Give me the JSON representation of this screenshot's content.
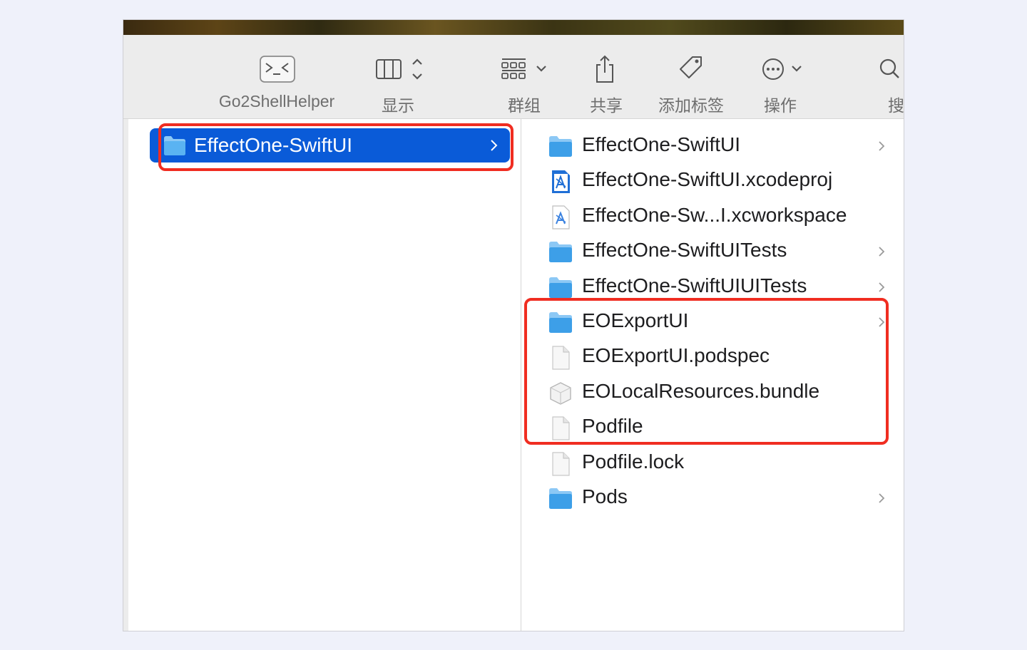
{
  "colors": {
    "selection": "#0a5bd8",
    "annotation": "#f02d21",
    "folder": "#3d9fe8",
    "toolbar_bg": "#ececec"
  },
  "toolbar": {
    "items": [
      {
        "label": "Go2ShellHelper",
        "icon": "terminal-icon"
      },
      {
        "label": "显示",
        "icon": "columns-view-icon"
      },
      {
        "label": "群组",
        "icon": "group-grid-icon"
      },
      {
        "label": "共享",
        "icon": "share-icon"
      },
      {
        "label": "添加标签",
        "icon": "tag-icon"
      },
      {
        "label": "操作",
        "icon": "ellipsis-circle-icon"
      },
      {
        "label": "搜索",
        "icon": "search-icon"
      }
    ]
  },
  "left_column": {
    "selected": {
      "name": "EffectOne-SwiftUI",
      "icon": "folder-icon"
    }
  },
  "right_column": {
    "items": [
      {
        "name": "EffectOne-SwiftUI",
        "icon": "folder-icon",
        "has_children": true
      },
      {
        "name": "EffectOne-SwiftUI.xcodeproj",
        "icon": "xcodeproj-icon",
        "has_children": false
      },
      {
        "name": "EffectOne-Sw...I.xcworkspace",
        "icon": "xcworkspace-icon",
        "has_children": false
      },
      {
        "name": "EffectOne-SwiftUITests",
        "icon": "folder-icon",
        "has_children": true
      },
      {
        "name": "EffectOne-SwiftUIUITests",
        "icon": "folder-icon",
        "has_children": true
      },
      {
        "name": "EOExportUI",
        "icon": "folder-icon",
        "has_children": true
      },
      {
        "name": "EOExportUI.podspec",
        "icon": "document-icon",
        "has_children": false
      },
      {
        "name": "EOLocalResources.bundle",
        "icon": "bundle-icon",
        "has_children": false
      },
      {
        "name": "Podfile",
        "icon": "document-icon",
        "has_children": false
      },
      {
        "name": "Podfile.lock",
        "icon": "document-icon",
        "has_children": false
      },
      {
        "name": "Pods",
        "icon": "folder-icon",
        "has_children": true
      }
    ]
  }
}
